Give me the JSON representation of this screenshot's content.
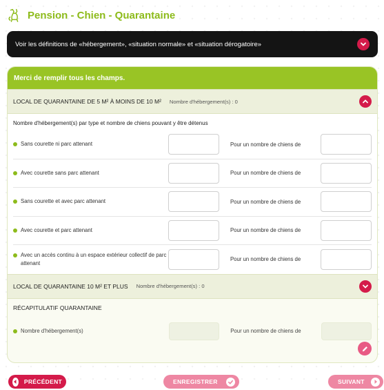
{
  "header": {
    "title": "Pension - Chien - Quarantaine",
    "icon": "dog-icon"
  },
  "definitions_bar": {
    "label": "Voir les définitions de «hébergement», «situation normale» et «situation dérogatoire»"
  },
  "form": {
    "notice": "Merci de remplir tous les champs.",
    "section1": {
      "title": "LOCAL DE QUARANTAINE DE 5 M² À MOINS DE 10 M²",
      "count": "Nombre d'hébergement(s) : 0",
      "expanded": true,
      "intro": "Nombre d'hébergement(s) par type et nombre de chiens pouvant y être détenus",
      "row_mid_label": "Pour un nombre de chiens de",
      "rows": [
        {
          "label": "Sans courette ni parc attenant",
          "count_value": "",
          "dogs_value": ""
        },
        {
          "label": "Avec courette sans parc attenant",
          "count_value": "",
          "dogs_value": ""
        },
        {
          "label": "Sans courette et avec parc attenant",
          "count_value": "",
          "dogs_value": ""
        },
        {
          "label": "Avec courette et parc attenant",
          "count_value": "",
          "dogs_value": ""
        },
        {
          "label": "Avec un accès continu à un espace extérieur collectif de parc attenant",
          "count_value": "",
          "dogs_value": ""
        }
      ]
    },
    "section2": {
      "title": "LOCAL DE QUARANTAINE 10 M² ET PLUS",
      "count": "Nombre d'hébergement(s) : 0",
      "expanded": false
    },
    "recap": {
      "title": "RÉCAPITULATIF QUARANTAINE",
      "row_label": "Nombre d'hébergement(s)",
      "mid_label": "Pour un nombre de chiens de"
    }
  },
  "footer": {
    "prev_label": "PRÉCÉDENT",
    "save_label": "ENREGISTRER",
    "next_label": "SUIVANT"
  },
  "colors": {
    "brand_green": "#8dbb1b",
    "accent_red": "#d41b4a",
    "accent_pink": "#ee87a3"
  }
}
